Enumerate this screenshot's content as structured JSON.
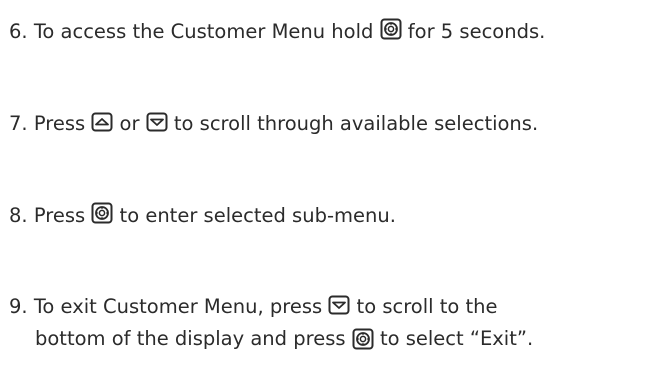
{
  "steps": [
    {
      "number": "6.",
      "before": "To access the Customer Menu hold",
      "icon": "select-icon",
      "after": "for 5 seconds."
    },
    {
      "number": "7.",
      "before": "Press",
      "icon1": "up-arrow-icon",
      "middle": "or",
      "icon2": "down-arrow-icon",
      "after": "to scroll through available selections."
    },
    {
      "number": "8.",
      "before": "Press",
      "icon": "select-icon",
      "after": "to enter selected sub-menu."
    },
    {
      "number": "9.",
      "before": "To exit Customer Menu, press",
      "icon": "down-arrow-icon",
      "after": "to scroll to the",
      "line2_before": "bottom of the display and press",
      "icon2": "select-icon",
      "line2_after": "to select “Exit”."
    }
  ]
}
